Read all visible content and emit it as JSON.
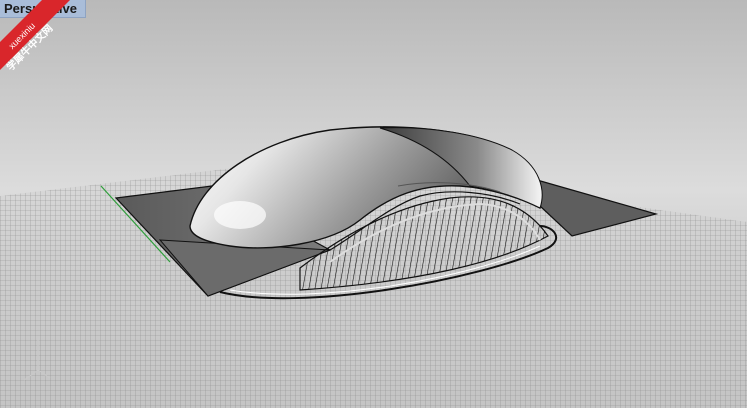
{
  "viewport": {
    "title": "Perspective"
  },
  "watermark": {
    "line1": "xuexiniu",
    "line2": "学犀牛中文网"
  },
  "colors": {
    "title_bar": "#a9bdd9",
    "watermark": "#d9262b",
    "grid_line": "#6a6a6a",
    "x_axis": "#8b1c1c",
    "y_axis": "#2e9e3a"
  },
  "icons": {
    "axis_widget": "world-axes-icon"
  }
}
